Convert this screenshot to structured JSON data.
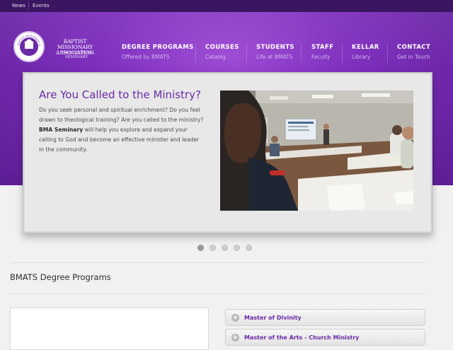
{
  "topbar": {
    "links": [
      "News",
      "Events"
    ]
  },
  "logo": {
    "seal_text": "BAPTIST MISSIONARY ASSOCIATION",
    "name": "BAPTIST MISSIONARY ASSOCIATION",
    "subtitle": "THEOLOGICAL SEMINARY"
  },
  "nav": [
    {
      "title": "DEGREE PROGRAMS",
      "sub": "Offered by BMATS"
    },
    {
      "title": "COURSES",
      "sub": "Catalog"
    },
    {
      "title": "STUDENTS",
      "sub": "Life at BMATS"
    },
    {
      "title": "STAFF",
      "sub": "Faculty"
    },
    {
      "title": "KELLAR",
      "sub": "Library"
    },
    {
      "title": "CONTACT",
      "sub": "Get in Touch"
    }
  ],
  "slide": {
    "title": "Are You Called to the Ministry?",
    "body_1": "Do you seek personal and spiritual enrichment? Do you feel drawn to theological training? Are you called to the ministry?",
    "body_bold": "BMA Seminary",
    "body_2": "will help you explore and expand your calling to God and become an effective minister and leader in the community."
  },
  "slider_dots": {
    "count": 5,
    "active": 1
  },
  "section": {
    "title": "BMATS Degree Programs"
  },
  "programs": [
    {
      "label": "Master of Divinity"
    },
    {
      "label": "Master of the Arts - Church Ministry"
    }
  ],
  "colors": {
    "brand_purple": "#7d2fbe",
    "topbar": "#3a1560",
    "link_purple": "#6a2aa6"
  }
}
